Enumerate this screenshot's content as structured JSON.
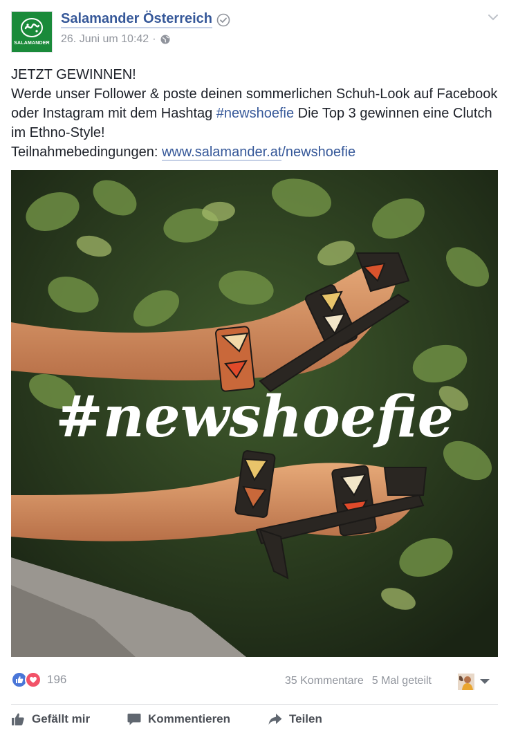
{
  "header": {
    "page_name": "Salamander Österreich",
    "brand_text": "SALAMANDER",
    "timestamp": "26. Juni um 10:42",
    "separator": "·",
    "icons": [
      "verified-icon",
      "globe-icon",
      "chevron-down-icon"
    ]
  },
  "post": {
    "line1": "JETZT GEWINNEN!",
    "line2_a": "Werde unser Follower & poste deinen sommerlichen Schuh-Look auf Facebook oder Instagram mit dem Hashtag ",
    "hashtag": "#newshoefie",
    "line2_b": " Die Top 3 gewinnen eine Clutch im Ethno-Style!",
    "terms_label": "Teilnahmebedingungen: ",
    "link_domain": "www.salamander.at",
    "link_path": "/newshoefie"
  },
  "image": {
    "overlay_text": "#newshoefie"
  },
  "stats": {
    "reaction_count": "196",
    "comments": "35 Kommentare",
    "shares": "5 Mal geteilt"
  },
  "actions": {
    "like": "Gefällt mir",
    "comment": "Kommentieren",
    "share": "Teilen"
  },
  "colors": {
    "link": "#365899",
    "brand_green": "#1a8a3a",
    "like_blue": "#4a76d8",
    "love_red": "#f25268"
  }
}
